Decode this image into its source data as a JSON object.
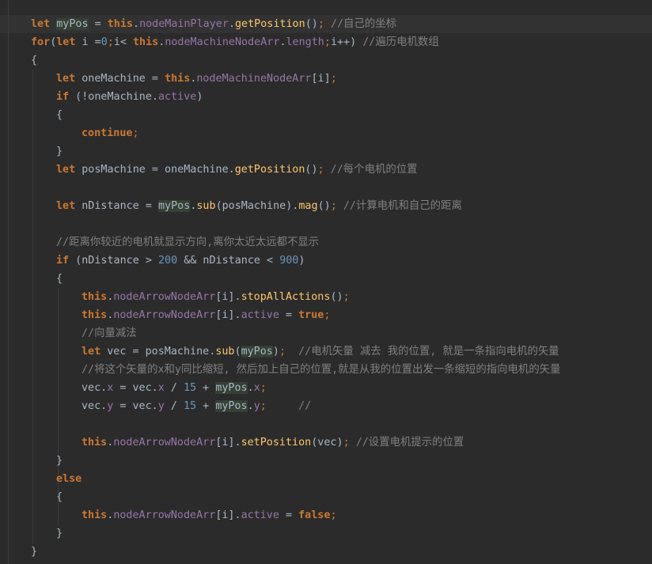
{
  "colors": {
    "background": "#2b2b2b",
    "current_line": "#323232",
    "keyword": "#cc7832",
    "field": "#9876aa",
    "method": "#ffc66d",
    "number": "#6897bb",
    "comment": "#808080",
    "default_text": "#a9b7c6",
    "usage_highlight": "#344134"
  },
  "code_lines": [
    {
      "indent": 1,
      "tokens": [
        {
          "k": "kw",
          "t": "let"
        },
        {
          "k": "pl",
          "t": " "
        },
        {
          "k": "pl",
          "t": "myPos",
          "mark": true
        },
        {
          "k": "pl",
          "t": " = "
        },
        {
          "k": "kw",
          "t": "this"
        },
        {
          "k": "pl",
          "t": "."
        },
        {
          "k": "fld",
          "t": "nodeMainPlayer"
        },
        {
          "k": "pl",
          "t": "."
        },
        {
          "k": "fn",
          "t": "getPosition"
        },
        {
          "k": "pl",
          "t": "()"
        },
        {
          "k": "pu",
          "t": ";"
        },
        {
          "k": "pl",
          "t": " "
        },
        {
          "k": "cmt",
          "t": "//自己的坐标"
        }
      ]
    },
    {
      "indent": 1,
      "tokens": [
        {
          "k": "kw",
          "t": "for"
        },
        {
          "k": "pl",
          "t": "("
        },
        {
          "k": "kw",
          "t": "let"
        },
        {
          "k": "pl",
          "t": " i ="
        },
        {
          "k": "num",
          "t": "0"
        },
        {
          "k": "pu",
          "t": ";"
        },
        {
          "k": "pl",
          "t": "i< "
        },
        {
          "k": "kw",
          "t": "this"
        },
        {
          "k": "pl",
          "t": "."
        },
        {
          "k": "fld",
          "t": "nodeMachineNodeArr"
        },
        {
          "k": "pl",
          "t": "."
        },
        {
          "k": "fld",
          "t": "length"
        },
        {
          "k": "pu",
          "t": ";"
        },
        {
          "k": "pl",
          "t": "i++) "
        },
        {
          "k": "cmt",
          "t": "//遍历电机数组"
        }
      ]
    },
    {
      "indent": 1,
      "tokens": [
        {
          "k": "pl",
          "t": "{"
        }
      ]
    },
    {
      "indent": 2,
      "tokens": [
        {
          "k": "kw",
          "t": "let"
        },
        {
          "k": "pl",
          "t": " oneMachine = "
        },
        {
          "k": "kw",
          "t": "this"
        },
        {
          "k": "pl",
          "t": "."
        },
        {
          "k": "fld",
          "t": "nodeMachineNodeArr"
        },
        {
          "k": "pl",
          "t": "[i]"
        },
        {
          "k": "pu",
          "t": ";"
        }
      ]
    },
    {
      "indent": 2,
      "tokens": [
        {
          "k": "kw",
          "t": "if"
        },
        {
          "k": "pl",
          "t": " (!oneMachine."
        },
        {
          "k": "fld",
          "t": "active"
        },
        {
          "k": "pl",
          "t": ")"
        }
      ]
    },
    {
      "indent": 2,
      "tokens": [
        {
          "k": "pl",
          "t": "{"
        }
      ]
    },
    {
      "indent": 3,
      "tokens": [
        {
          "k": "kw",
          "t": "continue"
        },
        {
          "k": "pu",
          "t": ";"
        }
      ]
    },
    {
      "indent": 2,
      "tokens": [
        {
          "k": "pl",
          "t": "}"
        }
      ]
    },
    {
      "indent": 2,
      "tokens": [
        {
          "k": "kw",
          "t": "let"
        },
        {
          "k": "pl",
          "t": " posMachine = oneMachine."
        },
        {
          "k": "fn",
          "t": "getPosition"
        },
        {
          "k": "pl",
          "t": "()"
        },
        {
          "k": "pu",
          "t": ";"
        },
        {
          "k": "pl",
          "t": " "
        },
        {
          "k": "cmt",
          "t": "//每个电机的位置"
        }
      ]
    },
    {
      "indent": 0,
      "tokens": []
    },
    {
      "indent": 2,
      "tokens": [
        {
          "k": "kw",
          "t": "let"
        },
        {
          "k": "pl",
          "t": " nDistance = "
        },
        {
          "k": "pl",
          "t": "myPos",
          "mark": true
        },
        {
          "k": "pl",
          "t": "."
        },
        {
          "k": "fn",
          "t": "sub"
        },
        {
          "k": "pl",
          "t": "(posMachine)."
        },
        {
          "k": "fn",
          "t": "mag"
        },
        {
          "k": "pl",
          "t": "()"
        },
        {
          "k": "pu",
          "t": ";"
        },
        {
          "k": "pl",
          "t": " "
        },
        {
          "k": "cmt",
          "t": "//计算电机和自己的距离"
        }
      ]
    },
    {
      "indent": 0,
      "tokens": []
    },
    {
      "indent": 2,
      "tokens": [
        {
          "k": "cmt",
          "t": "//距离你较近的电机就显示方向,离你太近太远都不显示"
        }
      ]
    },
    {
      "indent": 2,
      "tokens": [
        {
          "k": "kw",
          "t": "if"
        },
        {
          "k": "pl",
          "t": " (nDistance > "
        },
        {
          "k": "num",
          "t": "200"
        },
        {
          "k": "pl",
          "t": " && nDistance < "
        },
        {
          "k": "num",
          "t": "900"
        },
        {
          "k": "pl",
          "t": ")"
        }
      ]
    },
    {
      "indent": 2,
      "tokens": [
        {
          "k": "pl",
          "t": "{"
        }
      ]
    },
    {
      "indent": 3,
      "tokens": [
        {
          "k": "kw",
          "t": "this"
        },
        {
          "k": "pl",
          "t": "."
        },
        {
          "k": "fld",
          "t": "nodeArrowNodeArr"
        },
        {
          "k": "pl",
          "t": "[i]."
        },
        {
          "k": "fn",
          "t": "stopAllActions"
        },
        {
          "k": "pl",
          "t": "()"
        },
        {
          "k": "pu",
          "t": ";"
        }
      ]
    },
    {
      "indent": 3,
      "tokens": [
        {
          "k": "kw",
          "t": "this"
        },
        {
          "k": "pl",
          "t": "."
        },
        {
          "k": "fld",
          "t": "nodeArrowNodeArr"
        },
        {
          "k": "pl",
          "t": "[i]."
        },
        {
          "k": "fld",
          "t": "active"
        },
        {
          "k": "pl",
          "t": " = "
        },
        {
          "k": "kw",
          "t": "true"
        },
        {
          "k": "pu",
          "t": ";"
        }
      ]
    },
    {
      "indent": 3,
      "tokens": [
        {
          "k": "cmt",
          "t": "//向量减法"
        }
      ]
    },
    {
      "indent": 3,
      "tokens": [
        {
          "k": "kw",
          "t": "let"
        },
        {
          "k": "pl",
          "t": " vec = posMachine."
        },
        {
          "k": "fn",
          "t": "sub"
        },
        {
          "k": "pl",
          "t": "("
        },
        {
          "k": "pl",
          "t": "myPos",
          "mark": true
        },
        {
          "k": "pl",
          "t": ")"
        },
        {
          "k": "pu",
          "t": ";"
        },
        {
          "k": "pl",
          "t": "  "
        },
        {
          "k": "cmt",
          "t": "//电机矢量 减去 我的位置, 就是一条指向电机的矢量"
        }
      ]
    },
    {
      "indent": 3,
      "tokens": [
        {
          "k": "cmt",
          "t": "//将这个矢量的x和y同比缩短, 然后加上自己的位置,就是从我的位置出发一条缩短的指向电机的矢量"
        }
      ]
    },
    {
      "indent": 3,
      "tokens": [
        {
          "k": "pl",
          "t": "vec."
        },
        {
          "k": "fld",
          "t": "x"
        },
        {
          "k": "pl",
          "t": " = vec."
        },
        {
          "k": "fld",
          "t": "x"
        },
        {
          "k": "pl",
          "t": " / "
        },
        {
          "k": "num",
          "t": "15"
        },
        {
          "k": "pl",
          "t": " + "
        },
        {
          "k": "pl",
          "t": "myPos",
          "mark": true
        },
        {
          "k": "pl",
          "t": "."
        },
        {
          "k": "fld",
          "t": "x"
        },
        {
          "k": "pu",
          "t": ";"
        }
      ]
    },
    {
      "indent": 3,
      "tokens": [
        {
          "k": "pl",
          "t": "vec."
        },
        {
          "k": "fld",
          "t": "y"
        },
        {
          "k": "pl",
          "t": " = vec."
        },
        {
          "k": "fld",
          "t": "y"
        },
        {
          "k": "pl",
          "t": " / "
        },
        {
          "k": "num",
          "t": "15"
        },
        {
          "k": "pl",
          "t": " + "
        },
        {
          "k": "pl",
          "t": "myPos",
          "mark": true
        },
        {
          "k": "pl",
          "t": "."
        },
        {
          "k": "fld",
          "t": "y"
        },
        {
          "k": "pu",
          "t": ";"
        },
        {
          "k": "pl",
          "t": "     "
        },
        {
          "k": "cmt",
          "t": "//"
        }
      ]
    },
    {
      "indent": 0,
      "tokens": []
    },
    {
      "indent": 3,
      "tokens": [
        {
          "k": "kw",
          "t": "this"
        },
        {
          "k": "pl",
          "t": "."
        },
        {
          "k": "fld",
          "t": "nodeArrowNodeArr"
        },
        {
          "k": "pl",
          "t": "[i]."
        },
        {
          "k": "fn",
          "t": "setPosition"
        },
        {
          "k": "pl",
          "t": "(vec)"
        },
        {
          "k": "pu",
          "t": ";"
        },
        {
          "k": "pl",
          "t": " "
        },
        {
          "k": "cmt",
          "t": "//设置电机提示的位置"
        }
      ]
    },
    {
      "indent": 2,
      "tokens": [
        {
          "k": "pl",
          "t": "}"
        }
      ]
    },
    {
      "indent": 2,
      "tokens": [
        {
          "k": "kw",
          "t": "else"
        }
      ]
    },
    {
      "indent": 2,
      "tokens": [
        {
          "k": "pl",
          "t": "{"
        }
      ]
    },
    {
      "indent": 3,
      "tokens": [
        {
          "k": "kw",
          "t": "this"
        },
        {
          "k": "pl",
          "t": "."
        },
        {
          "k": "fld",
          "t": "nodeArrowNodeArr"
        },
        {
          "k": "pl",
          "t": "[i]."
        },
        {
          "k": "fld",
          "t": "active"
        },
        {
          "k": "pl",
          "t": " = "
        },
        {
          "k": "kw",
          "t": "false"
        },
        {
          "k": "pu",
          "t": ";"
        }
      ]
    },
    {
      "indent": 2,
      "tokens": [
        {
          "k": "pl",
          "t": "}"
        }
      ]
    },
    {
      "indent": 1,
      "tokens": [
        {
          "k": "pl",
          "t": "}"
        }
      ]
    }
  ]
}
